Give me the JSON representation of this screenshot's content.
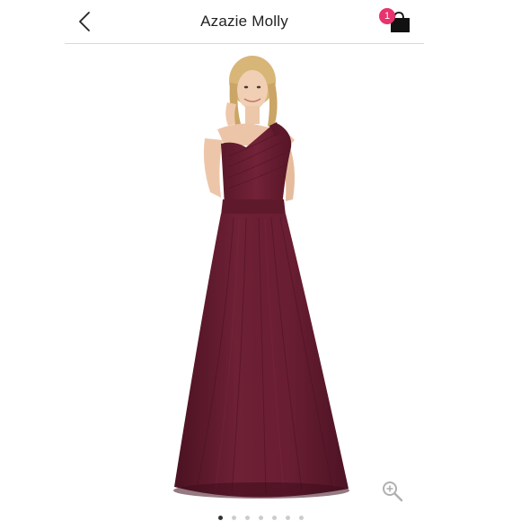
{
  "header": {
    "title": "Azazie Molly",
    "back_icon": "chevron-left-icon",
    "bag_icon": "shopping-bag-icon",
    "cart_count": "1"
  },
  "product": {
    "dress_color": "#6b1f33",
    "zoom_icon": "zoom-in-icon"
  },
  "gallery": {
    "total_images": 7,
    "active_index": 0
  },
  "colors": {
    "badge": "#e8336e",
    "dot_active": "#333333",
    "dot_inactive": "#cccccc"
  }
}
